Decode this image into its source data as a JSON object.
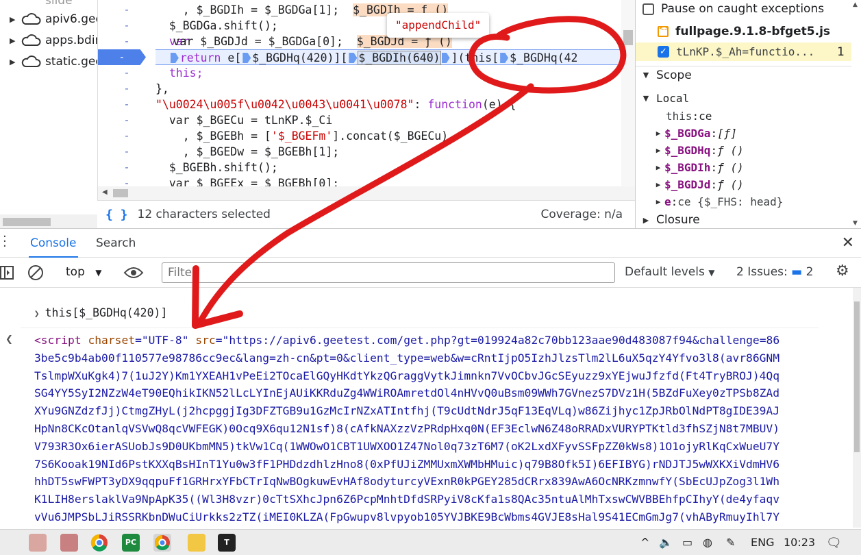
{
  "tree": {
    "items": [
      {
        "label": "slide"
      },
      {
        "label": "apiv6.gee"
      },
      {
        "label": "apps.bdir"
      },
      {
        "label": "static.gee"
      }
    ]
  },
  "editor": {
    "tooltip": "\"appendChild\"",
    "line_marker": "-",
    "lines": {
      "l1a": "    , $_BGDIh = $_BGDGa[1];",
      "l1b": "$_BGDIh = ƒ ()",
      "l2": "  $_BGDGa.shift();",
      "l3a": "  var $_BGDJd = $_BGDGa[0];",
      "l3b": "$_BGDJd = ƒ ()",
      "l4_return": "return",
      "l4a": " e[",
      "l4b": "$_BGDHq(420)",
      "l4c": "][",
      "l4d": "$_BGDIh(640)",
      "l4e": "](this[",
      "l4f": "$_BGDHq(42",
      "l5": "  this;",
      "l6": "},",
      "l7_key": "\"\\u0024\\u005f\\u0042\\u0043\\u0041\\u0078\"",
      "l7_rest": ": ",
      "l7_fn": "function",
      "l7_args": "(e) {",
      "l8": "  var $_BGECu = tLnKP.$_Ci",
      "l9a": "    , $_BGEBh = [",
      "l9s": "'$_BGEFm'",
      "l9b": "].concat($_BGECu)",
      "l10": "    , $_BGEDw = $_BGEBh[1];",
      "l11": "  $_BGEBh.shift();",
      "l12": "  var $_BGEEx = $_BGEBh[0];"
    }
  },
  "status": {
    "selection": "12 characters selected",
    "coverage": "Coverage: n/a"
  },
  "sidebar": {
    "pause_caught": "Pause on caught exceptions",
    "file_name": "fullpage.9.1.8-bfget5.js",
    "breakpoint_label": "tLnKP.$_Ah=functio...",
    "breakpoint_line": "1",
    "scope_header": "Scope",
    "local_header": "Local",
    "scope_vars": [
      {
        "name": "this",
        "value": "ce"
      },
      {
        "name": "$_BGDGa",
        "value": "[ƒ]"
      },
      {
        "name": "$_BGDHq",
        "value": "ƒ ()"
      },
      {
        "name": "$_BGDIh",
        "value": "ƒ ()"
      },
      {
        "name": "$_BGDJd",
        "value": "ƒ ()"
      },
      {
        "name": "e",
        "value": "ce {$_FHS: head}"
      }
    ],
    "closure_header": "Closure"
  },
  "drawer": {
    "tabs": [
      "Console",
      "Search"
    ],
    "active_tab": "Console"
  },
  "console_toolbar": {
    "context": "top",
    "filter_placeholder": "Filter",
    "levels": "Default levels",
    "issues_label": "2 Issues:",
    "issues_count": "2"
  },
  "console": {
    "command": "this[$_BGDHq(420)]",
    "result_tag_open": "<script",
    "result_attr1": "charset",
    "result_val1": "\"UTF-8\"",
    "result_attr2": "src",
    "result_lines": [
      "\"https://apiv6.geetest.com/get.php?gt=019924a82c70bb123aae90d483087f94&challenge=86",
      "3be5c9b4ab00f110577e98786cc9ec&lang=zh-cn&pt=0&client_type=web&w=cRntIjpO5IzhJlzsTlm2lL6uX5qzY4Yfvo3l8(avr86GNM",
      "TslmpWXuKgk4)7(1uJ2Y)Km1YXEAH1vPeEi2TOcaElGQyHKdtYkzQGraggVytkJimnkn7VvOCbvJGcSEyuzz9xYEjwuJfzfd(Ft4TryBROJ)4Qq",
      "SG4YY5SyI2NZzW4eT90EQhikIKN52lLcLYInEjAUiKKRduZg4WWiROAmretdOl4nHVvQ0uBsm09WWh7GVnezS7DVz1H(5BZdFuXey0zTPSb8ZAd",
      "XYu9GNZdzfJj)CtmgZHyL(j2hcpggjIg3DFZTGB9u1GzMcIrNZxATIntfhj(T9cUdtNdrJ5qF13EqVLq)w86Zijhyc1ZpJRbOlNdPT8gIDE39AJ",
      "HpNn8CKcOtanlqVSVwQ8qcVWFEGK)0Ocq9X6qu12N1sf)8(cAfkNAXzzVzPRdpHxq0N(EF3EclwN6Z48oRRADxVURYPTKtld3fhSZjN8t7MBUV)",
      "V793R3Ox6ierASUobJs9D0UKbmMN5)tkVw1Cq(1WWOwO1CBT1UWXOO1Z47Nol0q73zT6M7(oK2LxdXFyvSSFpZZ0kWs8)1O1ojyRlKqCxWueU7Y",
      "7S6Kooak19NId6PstKXXqBsHInT1Yu0w3fF1PHDdzdhlzHno8(0xPfUJiZMMUxmXWMbHMuic)q79B8Ofk5I)6EFIBYG)rNDJTJ5wWXKXiVdmHV6",
      "hhDT5swFWPT3yDX9qqpuFf1GRHrxYFbCTrIqNwBOgkuwEvHAf8odyturcyVExnR0kPGEY285dCRrx839AwA6OcNRKzmnwfY(SbEcUJpZog3l1Wh",
      "K1LIH8erslaklVa9NpApK35((Wl3H8vzr)0cTtSXhcJpn6Z6PcpMnhtDfdSRPyiV8cKfa1s8QAc35ntuAlMhTxswCWVBBEhfpCIhyY(de4yfaqv",
      "vVu6JMPSbLJiRSSRKbnDWuCiUrkks2zTZ(iMEI0KLZA(FpGwupv8lvpyob105YVJBKE9BcWbms4GVJE8sHal9S41ECmGmJg7(vhAByRmuyIhl7Y"
    ]
  },
  "taskbar": {
    "lang": "ENG",
    "time": "10:23"
  }
}
